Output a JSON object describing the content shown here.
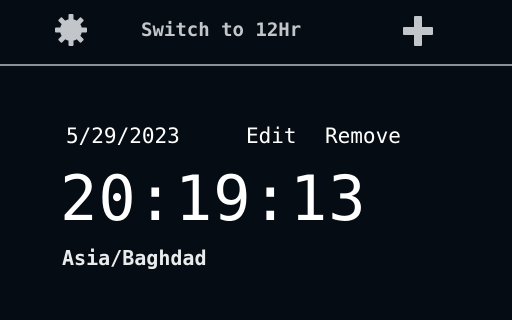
{
  "toolbar": {
    "settings_icon": "gear-icon",
    "toggle_format_label": "Switch to 12Hr",
    "add_icon": "plus-icon",
    "icon_color": "#c2c5c9",
    "divider_color": "#8a9097"
  },
  "clock": {
    "date": "5/29/2023",
    "edit_label": "Edit",
    "remove_label": "Remove",
    "time": "20:19:13",
    "timezone": "Asia/Baghdad"
  },
  "colors": {
    "background": "#050c13",
    "text": "#ffffff"
  }
}
